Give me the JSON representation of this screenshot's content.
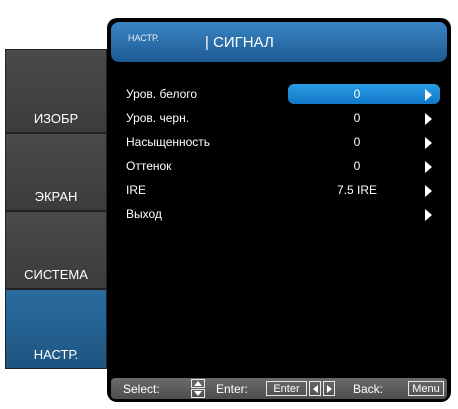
{
  "sidebar": {
    "tabs": [
      {
        "label": "ИЗОБР"
      },
      {
        "label": "ЭКРАН"
      },
      {
        "label": "СИСТЕМА"
      },
      {
        "label": "НАСТР."
      }
    ],
    "active_index": 3
  },
  "header": {
    "crumb": "НАСТР.",
    "title": "| СИГНАЛ"
  },
  "menu": {
    "items": [
      {
        "label": "Уров. белого",
        "value": "0"
      },
      {
        "label": "Уров. черн.",
        "value": "0"
      },
      {
        "label": "Насыщенность",
        "value": "0"
      },
      {
        "label": "Оттенок",
        "value": "0"
      },
      {
        "label": "IRE",
        "value": "7.5 IRE"
      },
      {
        "label": "Выход",
        "value": ""
      }
    ],
    "selected_index": 0
  },
  "footer": {
    "select_label": "Select:",
    "enter_label": "Enter:",
    "enter_key": "Enter",
    "back_label": "Back:",
    "menu_key": "Menu"
  },
  "colors": {
    "accent": "#1f8ad6",
    "active_tab": "#2a6c9e",
    "panel_bg": "#000000"
  }
}
